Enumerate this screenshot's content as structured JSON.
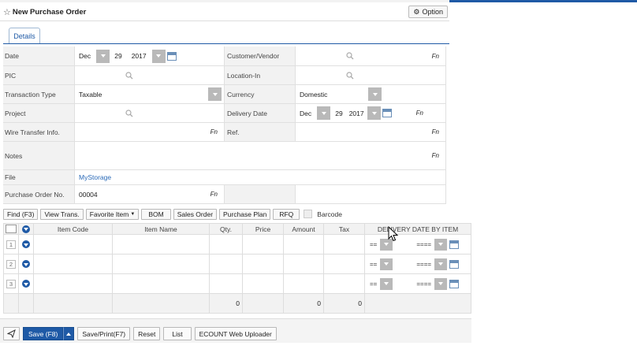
{
  "header": {
    "title": "New Purchase Order",
    "option_label": "Option"
  },
  "tabs": [
    {
      "label": "Details"
    }
  ],
  "form": {
    "date": {
      "label": "Date",
      "month": "Dec",
      "day": "29",
      "year": "2017"
    },
    "customer_vendor": {
      "label": "Customer/Vendor",
      "fn": "Fn"
    },
    "pic": {
      "label": "PIC"
    },
    "location_in": {
      "label": "Location-In"
    },
    "transaction_type": {
      "label": "Transaction Type",
      "value": "Taxable"
    },
    "currency": {
      "label": "Currency",
      "value": "Domestic"
    },
    "project": {
      "label": "Project"
    },
    "delivery_date": {
      "label": "Delivery Date",
      "month": "Dec",
      "day": "29",
      "year": "2017",
      "fn": "Fn"
    },
    "wire_transfer": {
      "label": "Wire Transfer Info.",
      "fn": "Fn"
    },
    "ref": {
      "label": "Ref.",
      "fn": "Fn"
    },
    "notes": {
      "label": "Notes",
      "fn": "Fn"
    },
    "file": {
      "label": "File",
      "value": "MyStorage"
    },
    "po_no": {
      "label": "Purchase Order No.",
      "value": "00004",
      "fn": "Fn"
    }
  },
  "toolbar": {
    "find": "Find (F3)",
    "view_trans": "View Trans.",
    "favorite": "Favorite Item",
    "bom": "BOM",
    "sales_order": "Sales Order",
    "purchase_plan": "Purchase Plan",
    "rfq": "RFQ",
    "barcode": "Barcode"
  },
  "grid": {
    "columns": [
      "Item Code",
      "Item Name",
      "Qty.",
      "Price",
      "Amount",
      "Tax",
      "DELIVERY DATE BY ITEM"
    ],
    "rows": [
      {
        "num": "1",
        "eq": "==",
        "date": "===="
      },
      {
        "num": "2",
        "eq": "==",
        "date": "===="
      },
      {
        "num": "3",
        "eq": "==",
        "date": "===="
      }
    ],
    "totals": {
      "qty": "0",
      "amount": "0",
      "tax": "0"
    }
  },
  "footer": {
    "save": "Save (F8)",
    "save_print": "Save/Print(F7)",
    "reset": "Reset",
    "list": "List",
    "uploader": "ECOUNT Web Uploader"
  }
}
